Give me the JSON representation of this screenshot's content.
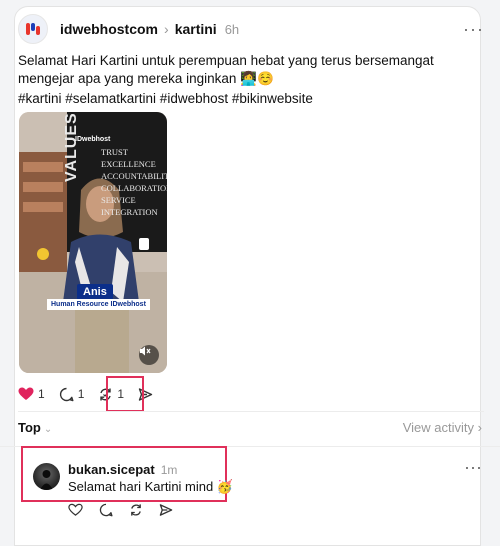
{
  "post": {
    "username": "idwebhostcom",
    "thread_name": "kartini",
    "time": "6h",
    "text": "Selamat Hari Kartini untuk perempuan hebat yang terus bersemangat mengejar apa yang mereka inginkan 👩‍💻☺️",
    "hashtags": "#kartini #selamatkartini #idwebhost #bikinwebsite",
    "video": {
      "caption_name": "Anis",
      "caption_role": "Human Resource IDwebhost",
      "brand": "IDwebhost",
      "values_vertical": "VALUES",
      "values_list": [
        "TRUST",
        "EXCELLENCE",
        "ACCOUNTABILITY",
        "COLLABORATION",
        "SERVICE",
        "INTEGRATION"
      ]
    },
    "likes": "1",
    "replies": "1",
    "reposts": "1"
  },
  "sort": {
    "label": "Top",
    "view_activity": "View activity"
  },
  "comment": {
    "username": "bukan.sicepat",
    "time": "1m",
    "text": "Selamat hari Kartini mind 🥳"
  },
  "colors": {
    "like_red": "#e0245e",
    "highlight": "#e0305a",
    "brand_blue": "#0b2e8a"
  }
}
